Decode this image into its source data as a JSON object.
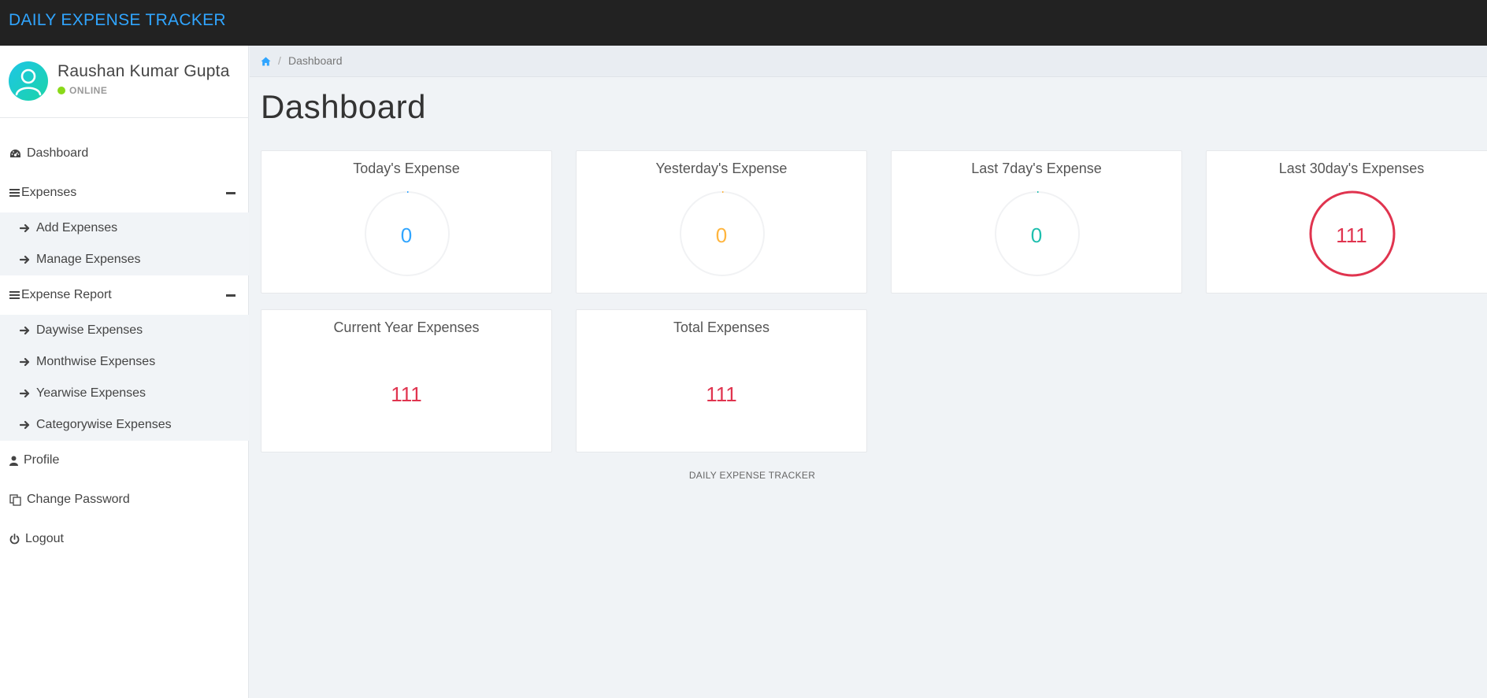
{
  "app": {
    "title": "DAILY EXPENSE TRACKER"
  },
  "user": {
    "name": "Raushan Kumar Gupta",
    "status": "ONLINE"
  },
  "sidebar": {
    "dashboard": "Dashboard",
    "expenses": {
      "label": "Expenses",
      "items": [
        "Add Expenses",
        "Manage Expenses"
      ]
    },
    "report": {
      "label": "Expense Report",
      "items": [
        "Daywise Expenses",
        "Monthwise Expenses",
        "Yearwise Expenses",
        "Categorywise Expenses"
      ]
    },
    "profile": "Profile",
    "change_password": "Change Password",
    "logout": "Logout"
  },
  "breadcrumb": {
    "current": "Dashboard"
  },
  "page": {
    "title": "Dashboard"
  },
  "cards": [
    {
      "title": "Today's Expense",
      "value": "0",
      "color": "#30a5ff",
      "percent": 0
    },
    {
      "title": "Yesterday's Expense",
      "value": "0",
      "color": "#ffb53e",
      "percent": 0
    },
    {
      "title": "Last 7day's Expense",
      "value": "0",
      "color": "#1ebfae",
      "percent": 0
    },
    {
      "title": "Last 30day's Expenses",
      "value": "111",
      "color": "#e0344f",
      "percent": 100
    },
    {
      "title": "Current Year Expenses",
      "value": "111",
      "color": "#e0344f"
    },
    {
      "title": "Total Expenses",
      "value": "111",
      "color": "#e0344f"
    }
  ],
  "footer": {
    "text": "DAILY EXPENSE TRACKER"
  },
  "colors": {
    "brand": "#30a5ff",
    "topbar": "#222222",
    "online": "#8ad919"
  }
}
